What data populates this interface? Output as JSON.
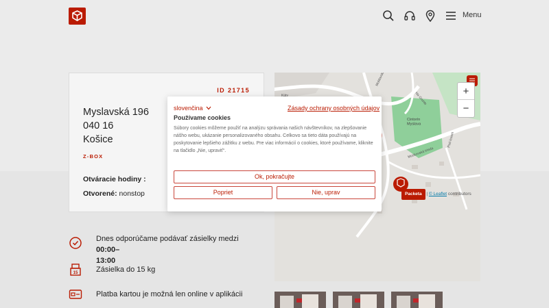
{
  "header": {
    "menu_label": "Menu",
    "icons": [
      "search-icon",
      "headset-icon",
      "map-pin-icon",
      "hamburger-icon"
    ]
  },
  "point": {
    "id_label": "ID 21715",
    "street": "Myslavská 196",
    "zip": "040 16",
    "city": "Košice",
    "type": "Z-BOX",
    "hours_label": "Otváracie hodiny :",
    "open_label": "Otvorené:",
    "open_value": "nonstop"
  },
  "map": {
    "zoom_in": "+",
    "zoom_out": "−",
    "brand": "Packeta",
    "attribution_sep": "|",
    "leaflet": "© Leaflet",
    "contributors": "contributors",
    "labels": {
      "cemetery": "Cintorín\nMyslava",
      "street1": "Na Grunte",
      "street2": "Moldavská",
      "street3": "Moskovská trieda",
      "street4": "Pod lesom",
      "street5": "Kúty"
    }
  },
  "info": {
    "recommend_prefix": "Dnes odporúčame podávať zásielky medzi ",
    "recommend_time": "00:00–",
    "recommend_time2": "13:00",
    "weight": "Zásielka do 15 kg",
    "card_payment": "Platba kartou je možná len online v aplikácii",
    "weight_badge": "15"
  },
  "cookie": {
    "language": "slovenčina",
    "privacy_link": "Zásady ochrany osobných údajov",
    "title": "Používame cookies",
    "body": "Súbory cookies môžeme použiť na analýzu správania našich návštevníkov, na zlepšovanie nášho webu, ukázanie personalizovaného obsahu. Celkovo sa tieto dáta používajú na poskytovanie lepšieho zážitku z webu. Pre viac informácií o cookies, ktoré používame, kliknite na tlačidlo „Nie, upraviť“.",
    "accept": "Ok, pokračujte",
    "preferences": "Popriet",
    "reject": "Nie, uprav"
  },
  "colors": {
    "brand": "#ba1b02",
    "park": "#8fcf9a"
  }
}
